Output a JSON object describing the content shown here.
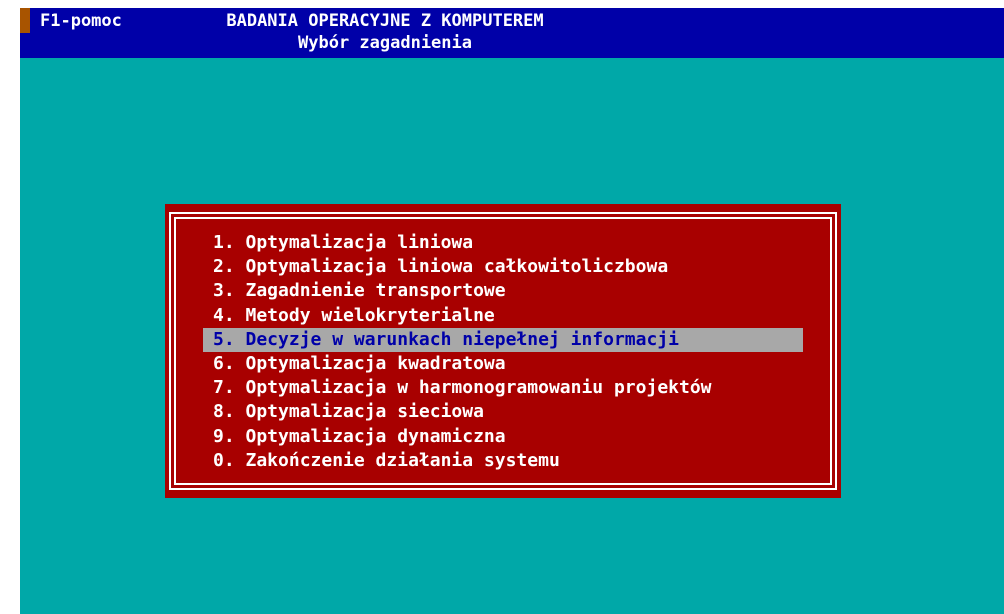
{
  "header": {
    "help_label": "F1-pomoc",
    "title": "BADANIA OPERACYJNE Z KOMPUTEREM",
    "subtitle": "Wybór zagadnienia"
  },
  "menu": {
    "selected_index": 4,
    "items": [
      {
        "label": "1. Optymalizacja liniowa"
      },
      {
        "label": "2. Optymalizacja liniowa całkowitoliczbowa"
      },
      {
        "label": "3. Zagadnienie transportowe"
      },
      {
        "label": "4. Metody wielokryterialne"
      },
      {
        "label": "5. Decyzje w warunkach niepełnej informacji"
      },
      {
        "label": "6. Optymalizacja kwadratowa"
      },
      {
        "label": "7. Optymalizacja w harmonogramowaniu projektów"
      },
      {
        "label": "8. Optymalizacja sieciowa"
      },
      {
        "label": "9. Optymalizacja dynamiczna"
      },
      {
        "label": "0. Zakończenie działania systemu"
      }
    ]
  },
  "colors": {
    "background": "#00a8a8",
    "header_bg": "#0000a8",
    "menu_bg": "#a80000",
    "highlight_bg": "#a8a8a8",
    "highlight_text": "#0000a8",
    "text": "#ffffff",
    "help_marker": "#a85400"
  }
}
